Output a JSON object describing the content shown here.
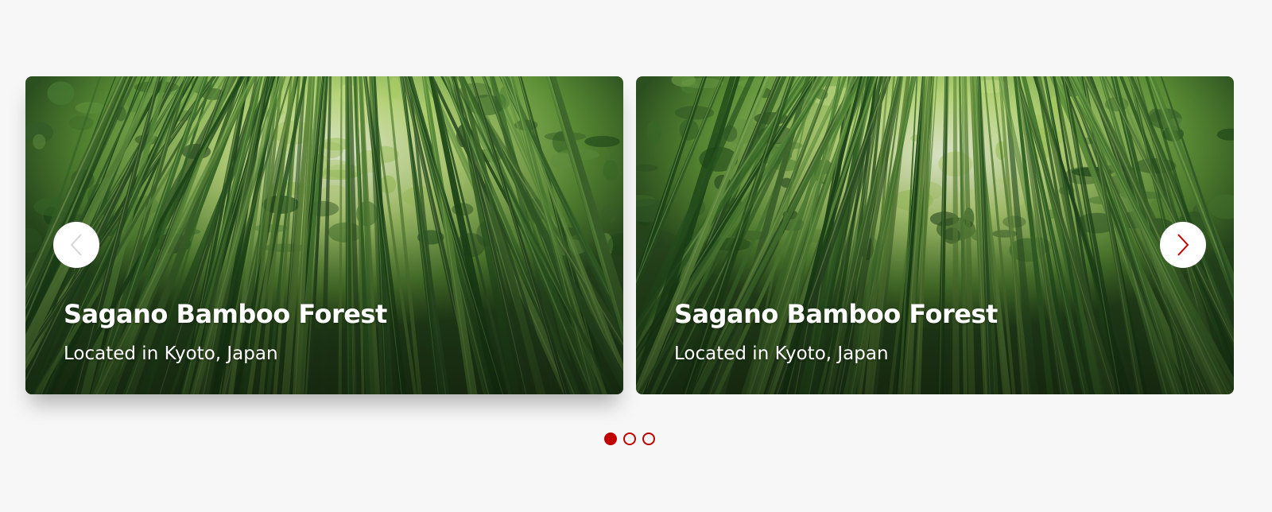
{
  "carousel": {
    "slides": [
      {
        "title": "Sagano Bamboo Forest",
        "subtitle": "Located in Kyoto, Japan",
        "image": "bamboo-forest-photo"
      },
      {
        "title": "Sagano Bamboo Forest",
        "subtitle": "Located in Kyoto, Japan",
        "image": "bamboo-forest-photo"
      }
    ],
    "prev_icon": "chevron-left-icon",
    "next_icon": "chevron-right-icon",
    "dots_total": 3,
    "active_dot": 1
  },
  "colors": {
    "accent": "#c00000",
    "prev_arrow_disabled": "#d6d6d6",
    "background": "#f7f7f7",
    "arrow_button_bg": "#ffffff"
  }
}
